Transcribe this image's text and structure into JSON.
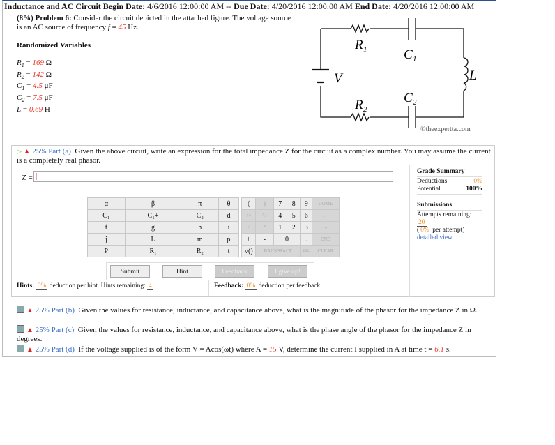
{
  "header": {
    "title": "Inductance and AC Circuit",
    "begin_label": "Begin Date:",
    "begin": "4/6/2016 12:00:00 AM",
    "sep": "--",
    "due_label": "Due Date:",
    "due": "4/20/2016 12:00:00 AM",
    "end_label": "End Date:",
    "end": "4/20/2016 12:00:00 AM"
  },
  "problem": {
    "weight": "(8%) Problem 6:",
    "text1": "Consider the circuit depicted in the attached figure. The voltage source is an AC source of frequency",
    "var": "f",
    "eq": " = ",
    "freq": "45",
    "unit": " Hz."
  },
  "random_vars": {
    "heading": "Randomized Variables",
    "items": [
      {
        "name": "R",
        "sub": "1",
        "value": "169",
        "unit": "Ω"
      },
      {
        "name": "R",
        "sub": "2",
        "value": "142",
        "unit": "Ω"
      },
      {
        "name": "C",
        "sub": "1",
        "value": "4.5",
        "unit": "μF"
      },
      {
        "name": "C",
        "sub": "2",
        "value": "7.5",
        "unit": "μF"
      },
      {
        "name": "L",
        "sub": "",
        "value": "0.69",
        "unit": "H"
      }
    ]
  },
  "figure": {
    "labels": {
      "r1": "R",
      "r1s": "1",
      "c1": "C",
      "c1s": "1",
      "l": "L",
      "v": "V",
      "r2": "R",
      "r2s": "2",
      "c2": "C",
      "c2s": "2"
    },
    "copyright": "©theexpertta.com"
  },
  "part_a": {
    "pct": "25% Part (a)",
    "text": "Given the above circuit, write an expression for the total impedance Z for the circuit as a complex number. You may assume the current is a completely real phasor.",
    "input_label": "Z =",
    "input_value": ""
  },
  "grade": {
    "title": "Grade Summary",
    "deductions_label": "Deductions",
    "deductions": "0%",
    "potential_label": "Potential",
    "potential": "100%",
    "subm_title": "Submissions",
    "attempts_label": "Attempts remaining:",
    "attempts": "20",
    "per_attempt_pct": "0%",
    "per_attempt": "per attempt)",
    "detailed": "detailed view"
  },
  "keypad": {
    "vars": [
      [
        "α",
        "β",
        "π",
        "θ"
      ],
      [
        "C₁",
        "C₁+",
        "C₂",
        "d"
      ],
      [
        "f",
        "g",
        "h",
        "i"
      ],
      [
        "j",
        "L",
        "m",
        "p"
      ],
      [
        "P",
        "R₁",
        "R₂",
        "t"
      ]
    ],
    "ops": {
      "lp": "(",
      "rp": ")",
      "7": "7",
      "8": "8",
      "9": "9",
      "home": "HOME",
      "up": "↑^",
      "dn": "^↓",
      "4": "4",
      "5": "5",
      "6": "6",
      "left": "←",
      "div": "/",
      "mul": "*",
      "1": "1",
      "2": "2",
      "3": "3",
      "right": "→",
      "plus": "+",
      "minus": "-",
      "0": "0",
      "dot": ".",
      "end": "END",
      "sqrt": "√()",
      "bksp": "BACKSPACE",
      "del": "DEL",
      "clear": "CLEAR"
    }
  },
  "buttons": {
    "submit": "Submit",
    "hint": "Hint",
    "feedback": "Feedback",
    "giveup": "I give up!"
  },
  "hints": {
    "label": "Hints:",
    "pct": "0%",
    "text": "deduction per hint. Hints remaining:",
    "remaining": "4"
  },
  "feedback": {
    "label": "Feedback:",
    "pct": "0%",
    "text": "deduction per feedback."
  },
  "parts": [
    {
      "pct": "25% Part (b)",
      "text": "Given the values for resistance, inductance, and capacitance above, what is the magnitude of the phasor for the impedance Z in Ω."
    },
    {
      "pct": "25% Part (c)",
      "text": "Given the values for resistance, inductance, and capacitance above, what is the phase angle of the phasor for the impedance Z in degrees."
    },
    {
      "pct": "25% Part (d)",
      "text_a": "If the voltage supplied is of the form V = Acos(ωt) where A =",
      "a": "15",
      "text_b": "V, determine the current I supplied in A at time t =",
      "t": "6.1",
      "text_c": "s."
    }
  ]
}
